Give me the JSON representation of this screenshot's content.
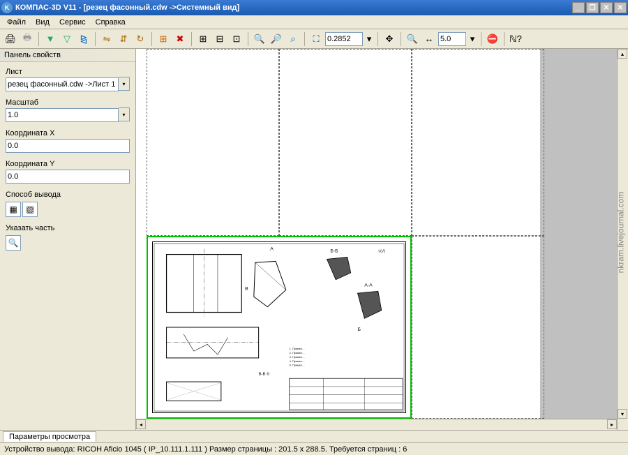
{
  "titlebar": {
    "app_icon_letter": "K",
    "title": "КОМПАС-3D V11 - [резец фасонный.cdw ->Системный вид]"
  },
  "menu": {
    "file": "Файл",
    "view": "Вид",
    "service": "Сервис",
    "help": "Справка"
  },
  "toolbar": {
    "zoom_value": "0.2852",
    "step_value": "5.0"
  },
  "panel": {
    "header": "Панель свойств",
    "sheet_label": "Лист",
    "sheet_value": "резец фасонный.cdw ->Лист 1",
    "scale_label": "Масштаб",
    "scale_value": "1.0",
    "coordx_label": "Координата X",
    "coordx_value": "0.0",
    "coordy_label": "Координата Y",
    "coordy_value": "0.0",
    "output_label": "Способ вывода",
    "select_part_label": "Указать часть"
  },
  "tabs": {
    "name": "Параметры просмотра"
  },
  "status": {
    "text": "Устройство вывода: RICOH Aficio 1045 ( IP_10.111.1.111 )   Размер страницы : 201.5 x 288.5.   Требуется страниц : 6"
  },
  "watermark": "nkram.livejournal.com",
  "drawing": {
    "labels": {
      "a": "А",
      "b": "Б",
      "v": "В",
      "bb": "Б-Б",
      "aa": "А-А",
      "section_vv": "В-В"
    }
  }
}
